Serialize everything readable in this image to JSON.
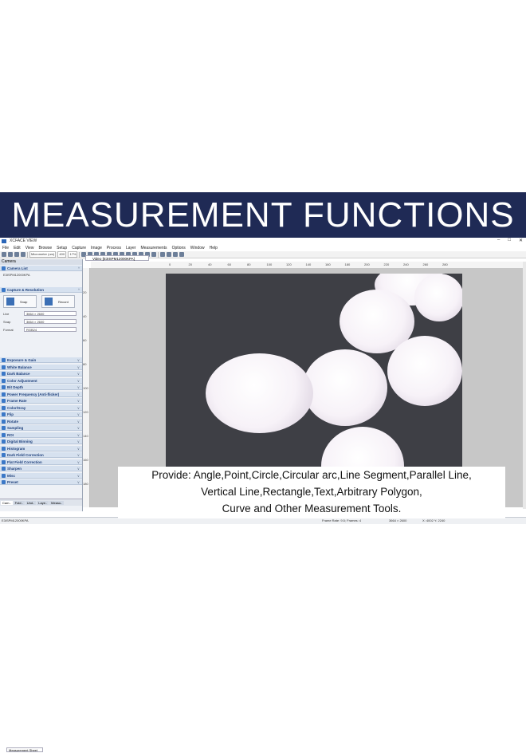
{
  "banner": {
    "title": "MEASUREMENT FUNCTIONS"
  },
  "colors": {
    "banner_bg": "#1f2a55",
    "banner_text": "#ffffff",
    "panel_accent": "#1c3e7a",
    "image_bg": "#3e3f45"
  },
  "window": {
    "title": "XCFACE VIEW",
    "controls": [
      "–",
      "□",
      "✕"
    ]
  },
  "menu": [
    "File",
    "Edit",
    "View",
    "Browse",
    "Setup",
    "Capture",
    "Image",
    "Process",
    "Layer",
    "Measurements",
    "Options",
    "Window",
    "Help"
  ],
  "toolbar": {
    "unit_select": "Micrometer (um)",
    "magnification_select": "40X",
    "zoom_select": "17%"
  },
  "panel": {
    "header": "Camera",
    "camera_list": {
      "title": "Camera List",
      "device": "E3ISPM12000KPA"
    },
    "capture": {
      "title": "Capture & Resolution",
      "snap_label": "Snap",
      "record_label": "Record",
      "live_label": "Live",
      "live_value": "3664 × 2600",
      "snap_res_label": "Snap",
      "snap_res_value": "3664 × 2600",
      "format_label": "Format",
      "format_value": "RGB24"
    },
    "sections": [
      "Exposure & Gain",
      "White Balance",
      "Dark Balance",
      "Color Adjustment",
      "Bit Depth",
      "Power Frequency (Anti-flicker)",
      "Frame Rate",
      "Color/Gray",
      "Flip",
      "Rotate",
      "Sampling",
      "ROI",
      "Digital Binning",
      "Histogram",
      "Dark Field Correction",
      "Flat Field Correction",
      "Sharpen",
      "Misc",
      "Preset"
    ],
    "tabs": [
      "Cam..",
      "Fold..",
      "Und..",
      "Laye..",
      "Measu.."
    ]
  },
  "viewer": {
    "tab_label": "Video [E3ISPM12000KPA]",
    "ruler_ticks": [
      "0",
      "20",
      "40",
      "60",
      "80",
      "100",
      "120",
      "140",
      "160",
      "180",
      "200",
      "220",
      "240",
      "260",
      "280"
    ],
    "ruler_left_ticks": [
      "20",
      "40",
      "60",
      "80",
      "100",
      "120",
      "140",
      "160",
      "180"
    ]
  },
  "overlay": {
    "line1": "Provide: Angle,Point,Circle,Circular arc,Line Segment,Parallel Line,",
    "line2": "Vertical Line,Rectangle,Text,Arbitrary Polygon,",
    "line3": "Curve and Other Measurement Tools."
  },
  "status": {
    "device": "E3ISPM12000KPA",
    "frame_info": "Frame Rate: 9.5; Frames: 4",
    "resolution": "3664 × 2600",
    "cursor": "X: 4002 Y: 2240",
    "sheet_tab": "Measurement Sheet"
  }
}
